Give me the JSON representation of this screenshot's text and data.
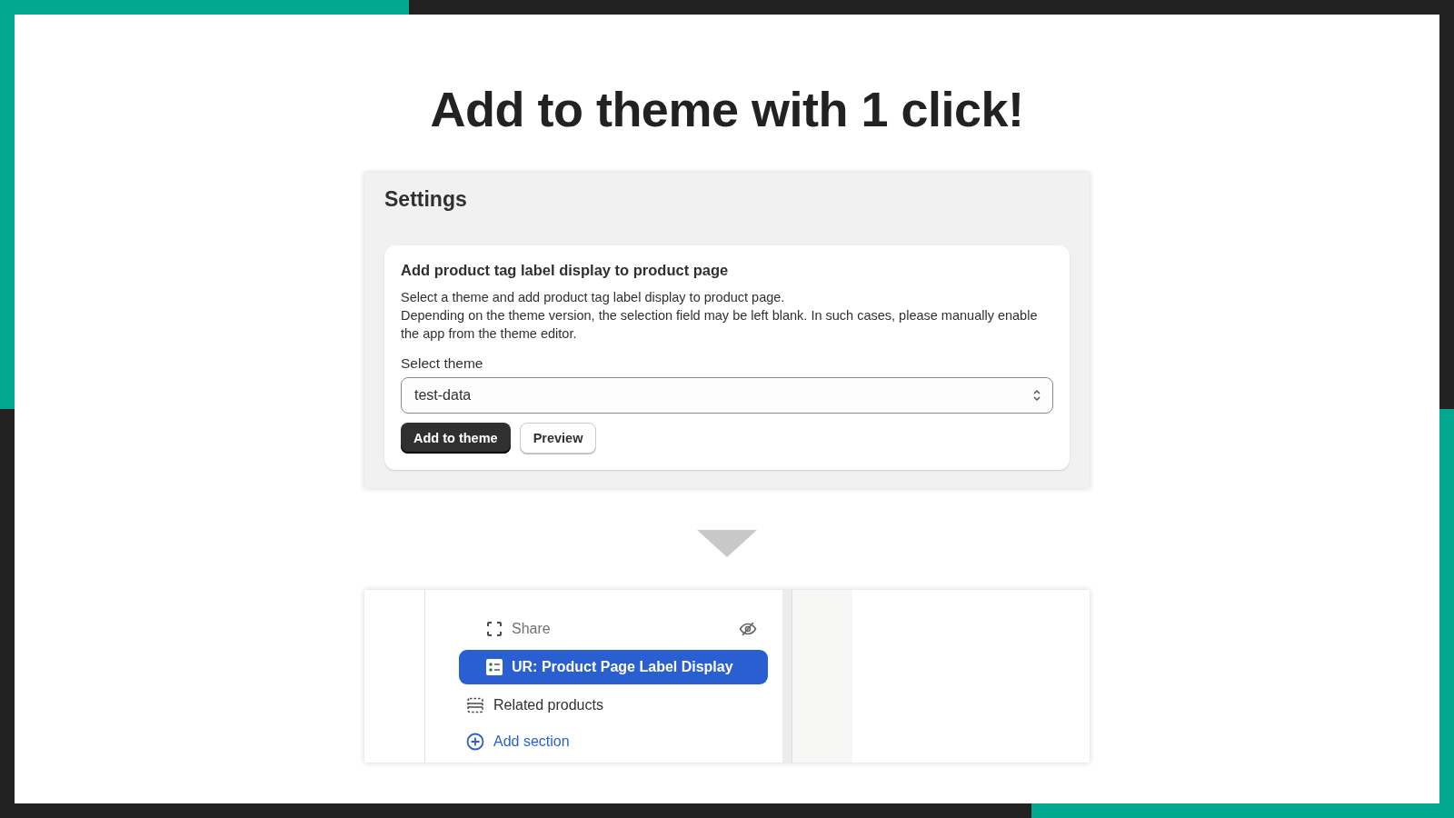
{
  "title": "Add to theme with 1 click!",
  "settings": {
    "heading": "Settings",
    "card": {
      "title": "Add product tag label display to product page",
      "description": [
        "Select a theme and add product tag label display to product page.",
        "Depending on the theme version, the selection field may be left blank. In such cases, please manually enable the app from the theme editor."
      ],
      "field_label": "Select theme",
      "select_value": "test-data",
      "buttons": [
        {
          "label": "Add to theme",
          "kind": "primary"
        },
        {
          "label": "Preview",
          "kind": "secondary"
        }
      ]
    }
  },
  "theme_editor": {
    "items": [
      {
        "label": "Share",
        "kind": "block",
        "hidden": true,
        "selected": false
      },
      {
        "label": "UR: Product Page Label Display",
        "kind": "app-block",
        "hidden": false,
        "selected": true
      },
      {
        "label": "Related products",
        "kind": "section",
        "hidden": false,
        "selected": false
      }
    ],
    "add_section": "Add section"
  }
}
